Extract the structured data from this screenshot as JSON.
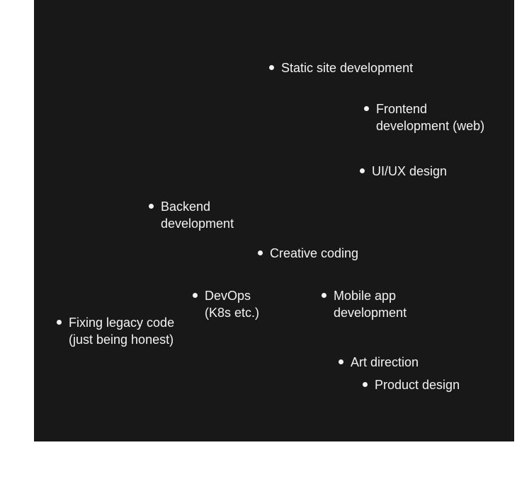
{
  "skills": [
    {
      "id": "static-site-development",
      "label": "Static site development"
    },
    {
      "id": "frontend-development",
      "label": "Frontend\ndevelopment (web)"
    },
    {
      "id": "ui-ux-design",
      "label": "UI/UX design"
    },
    {
      "id": "backend-development",
      "label": "Backend\ndevelopment"
    },
    {
      "id": "creative-coding",
      "label": "Creative coding"
    },
    {
      "id": "devops",
      "label": "DevOps\n(K8s etc.)"
    },
    {
      "id": "mobile-app-development",
      "label": "Mobile app\ndevelopment"
    },
    {
      "id": "fixing-legacy-code",
      "label": "Fixing legacy code\n(just being honest)"
    },
    {
      "id": "art-direction",
      "label": "Art direction"
    },
    {
      "id": "product-design",
      "label": "Product design"
    }
  ],
  "colors": {
    "panel_background": "#181818",
    "text": "#f2f2f2",
    "page_background": "#ffffff"
  }
}
